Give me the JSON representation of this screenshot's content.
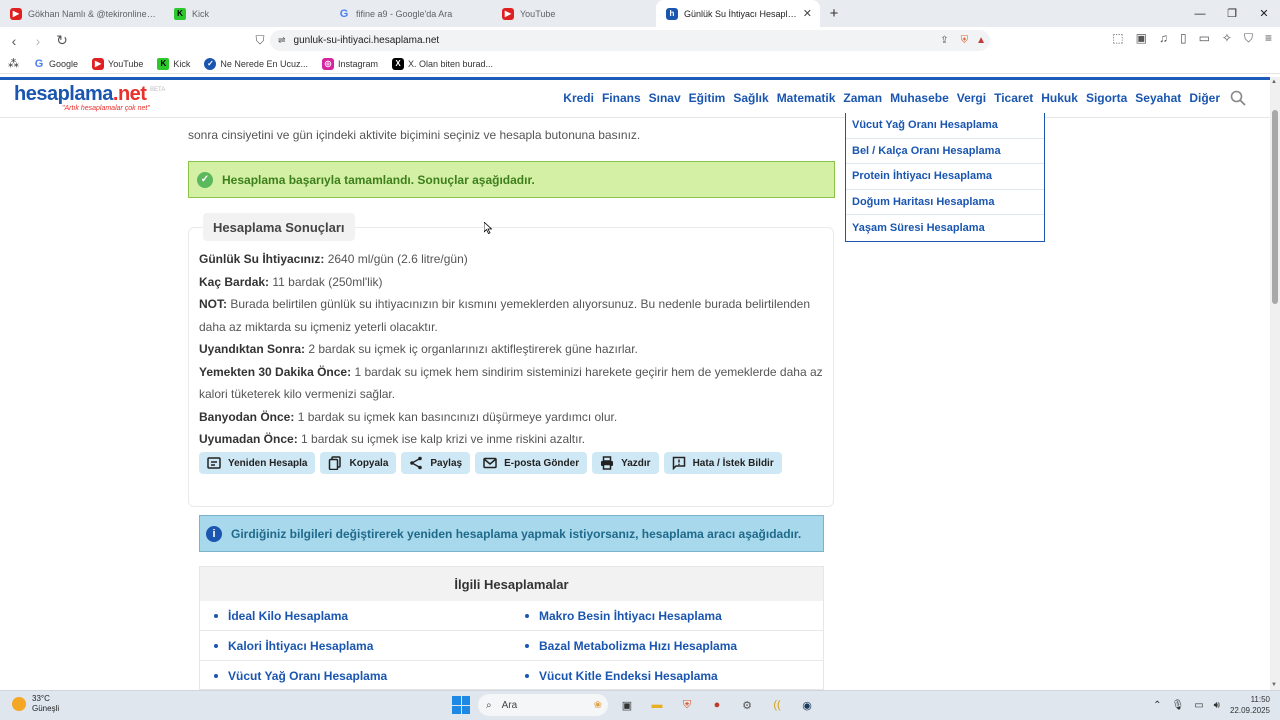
{
  "browser": {
    "tabs": [
      {
        "title": "Gökhan Namlı & @tekironline - Vura",
        "favicon": "youtube-icon"
      },
      {
        "title": "Kick",
        "favicon": "kick-icon"
      },
      {
        "title": "fifine a9 - Google'da Ara",
        "favicon": "google-icon"
      },
      {
        "title": "YouTube",
        "favicon": "youtube-icon"
      },
      {
        "title": "Günlük Su İhtiyacı Hesaplama - H",
        "favicon": "hesaplama-icon",
        "active": true
      }
    ],
    "url": "gunluk-su-ihtiyaci.hesaplama.net",
    "bookmarks": [
      "Google",
      "YouTube",
      "Kick",
      "Ne Nerede En Ucuz...",
      "Instagram",
      "X. Olan biten burad..."
    ]
  },
  "site": {
    "logo_main": "hesaplama",
    "logo_dot": ".net",
    "logo_tagline": "\"Artık hesaplamalar çok net\"",
    "logo_beta": "BETA",
    "nav": [
      "Kredi",
      "Finans",
      "Sınav",
      "Eğitim",
      "Sağlık",
      "Matematik",
      "Zaman",
      "Muhasebe",
      "Vergi",
      "Ticaret",
      "Hukuk",
      "Sigorta",
      "Seyahat",
      "Diğer"
    ]
  },
  "content": {
    "intro_text": "sonra cinsiyetini ve gün içindeki aktivite biçimini seçiniz ve hesapla butonuna basınız.",
    "success_msg": "Hesaplama başarıyla tamamlandı. Sonuçlar aşağıdadır.",
    "results_title": "Hesaplama Sonuçları",
    "results": [
      {
        "label": "Günlük Su İhtiyacınız:",
        "value": "2640 ml/gün (2.6 litre/gün)"
      },
      {
        "label": "Kaç Bardak:",
        "value": "11 bardak (250ml'lik)"
      },
      {
        "label": "NOT:",
        "value": "Burada belirtilen günlük su ihtiyacınızın bir kısmını yemeklerden alıyorsunuz. Bu nedenle burada belirtilenden daha az miktarda su içmeniz yeterli olacaktır."
      },
      {
        "label": "Uyandıktan Sonra:",
        "value": "2 bardak su içmek iç organlarınızı aktifleştirerek güne hazırlar."
      },
      {
        "label": "Yemekten 30 Dakika Önce:",
        "value": "1 bardak su içmek hem sindirim sisteminizi harekete geçirir hem de yemeklerde daha az kalori tüketerek kilo vermenizi sağlar."
      },
      {
        "label": "Banyodan Önce:",
        "value": "1 bardak su içmek kan basıncınızı düşürmeye yardımcı olur."
      },
      {
        "label": "Uyumadan Önce:",
        "value": "1 bardak su içmek ise kalp krizi ve inme riskini azaltır."
      }
    ],
    "actions": [
      "Yeniden Hesapla",
      "Kopyala",
      "Paylaş",
      "E-posta Gönder",
      "Yazdır",
      "Hata / İstek Bildir"
    ],
    "info_msg": "Girdiğiniz bilgileri değiştirerek yeniden hesaplama yapmak istiyorsanız, hesaplama aracı aşağıdadır.",
    "related_title": "İlgili Hesaplamalar",
    "related": [
      "İdeal Kilo Hesaplama",
      "Makro Besin İhtiyacı Hesaplama",
      "Kalori İhtiyacı Hesaplama",
      "Bazal Metabolizma Hızı Hesaplama",
      "Vücut Yağ Oranı Hesaplama",
      "Vücut Kitle Endeksi Hesaplama"
    ]
  },
  "sidebar": [
    "Vücut Yağ Oranı Hesaplama",
    "Bel / Kalça Oranı Hesaplama",
    "Protein İhtiyacı Hesaplama",
    "Doğum Haritası Hesaplama",
    "Yaşam Süresi Hesaplama"
  ],
  "taskbar": {
    "temp": "33°C",
    "weather": "Güneşli",
    "search": "Ara",
    "time": "11:50",
    "date": "22.09.2025"
  }
}
